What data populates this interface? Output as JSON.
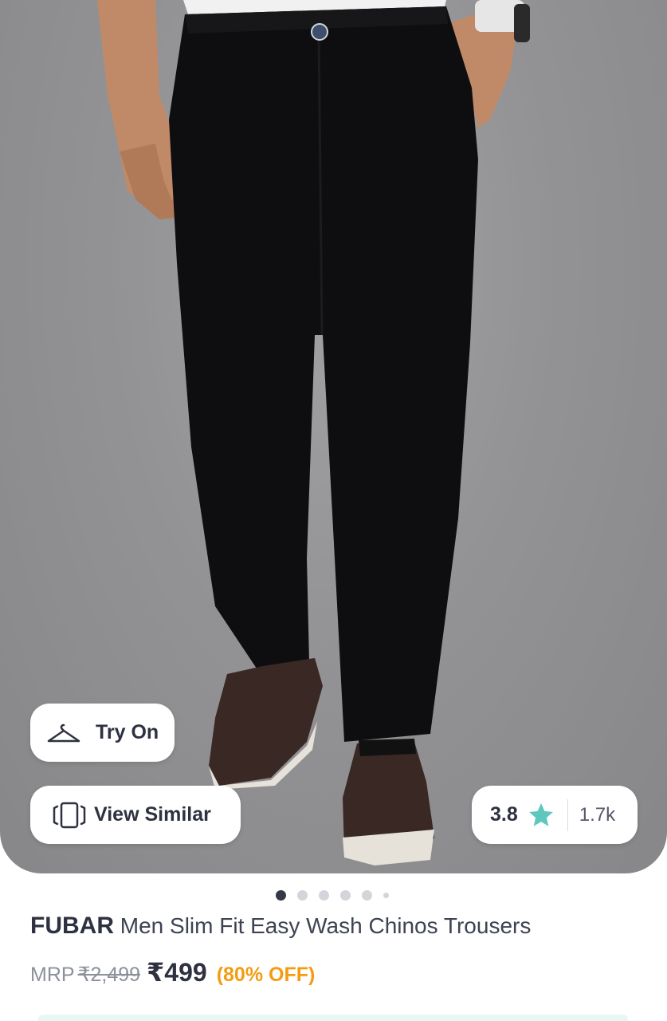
{
  "try_on": {
    "label": "Try On",
    "icon": "hanger-icon"
  },
  "view_similar": {
    "label": "View Similar",
    "icon": "similar-icon"
  },
  "rating": {
    "value": "3.8",
    "count": "1.7k",
    "star_color": "#5ec8bf"
  },
  "carousel": {
    "total": 6,
    "active_index": 0
  },
  "product": {
    "brand": "FUBAR",
    "name": "Men Slim Fit Easy Wash Chinos Trousers"
  },
  "pricing": {
    "mrp_label": "MRP",
    "mrp": "₹2,499",
    "price": "₹499",
    "discount": "(80% OFF)",
    "discount_color": "#f39c12"
  }
}
